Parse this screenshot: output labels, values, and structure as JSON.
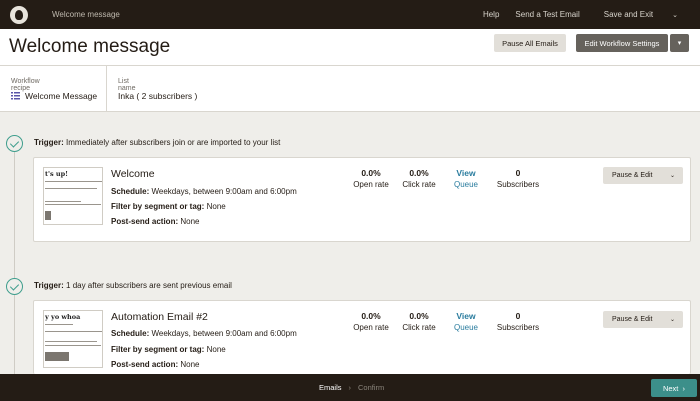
{
  "topbar": {
    "breadcrumb": "Welcome message",
    "help": "Help",
    "send_test": "Send a Test Email",
    "save_exit": "Save and Exit",
    "chevron": "⌄"
  },
  "header": {
    "title": "Welcome message",
    "pause_all": "Pause All Emails",
    "edit_settings": "Edit Workflow Settings",
    "chevron": "▾"
  },
  "recipe": {
    "label": "Workflow recipe",
    "value": "Welcome Message",
    "icon": "list-icon"
  },
  "list": {
    "label": "List name",
    "value": "Inka ( 2 subscribers )"
  },
  "emails": [
    {
      "trigger_label": "Trigger:",
      "trigger_text": "Immediately after subscribers join or are imported to your list",
      "title": "Welcome",
      "thumb_text": "t's up!",
      "schedule_label": "Schedule:",
      "schedule": "Weekdays, between 9:00am and 6:00pm",
      "filter_label": "Filter by segment or tag:",
      "filter": "None",
      "post_label": "Post-send action:",
      "post": "None",
      "open_value": "0.0%",
      "open_label": "Open rate",
      "click_value": "0.0%",
      "click_label": "Click rate",
      "view_label": "View",
      "queue_label": "Queue",
      "subs_value": "0",
      "subs_label": "Subscribers",
      "action": "Pause & Edit",
      "chevron": "⌄"
    },
    {
      "trigger_label": "Trigger:",
      "trigger_text": "1 day after subscribers are sent previous email",
      "title": "Automation Email #2",
      "thumb_text": "y yo whoa",
      "schedule_label": "Schedule:",
      "schedule": "Weekdays, between 9:00am and 6:00pm",
      "filter_label": "Filter by segment or tag:",
      "filter": "None",
      "post_label": "Post-send action:",
      "post": "None",
      "open_value": "0.0%",
      "open_label": "Open rate",
      "click_value": "0.0%",
      "click_label": "Click rate",
      "view_label": "View",
      "queue_label": "Queue",
      "subs_value": "0",
      "subs_label": "Subscribers",
      "action": "Pause & Edit",
      "chevron": "⌄"
    }
  ],
  "footer": {
    "step1": "Emails",
    "sep": "›",
    "step2": "Confirm",
    "next": "Next",
    "next_chevron": "›"
  },
  "colors": {
    "topbar": "#241c15",
    "accent": "#3c8f8a",
    "link": "#2a7c9e",
    "check": "#3f9e8d"
  }
}
